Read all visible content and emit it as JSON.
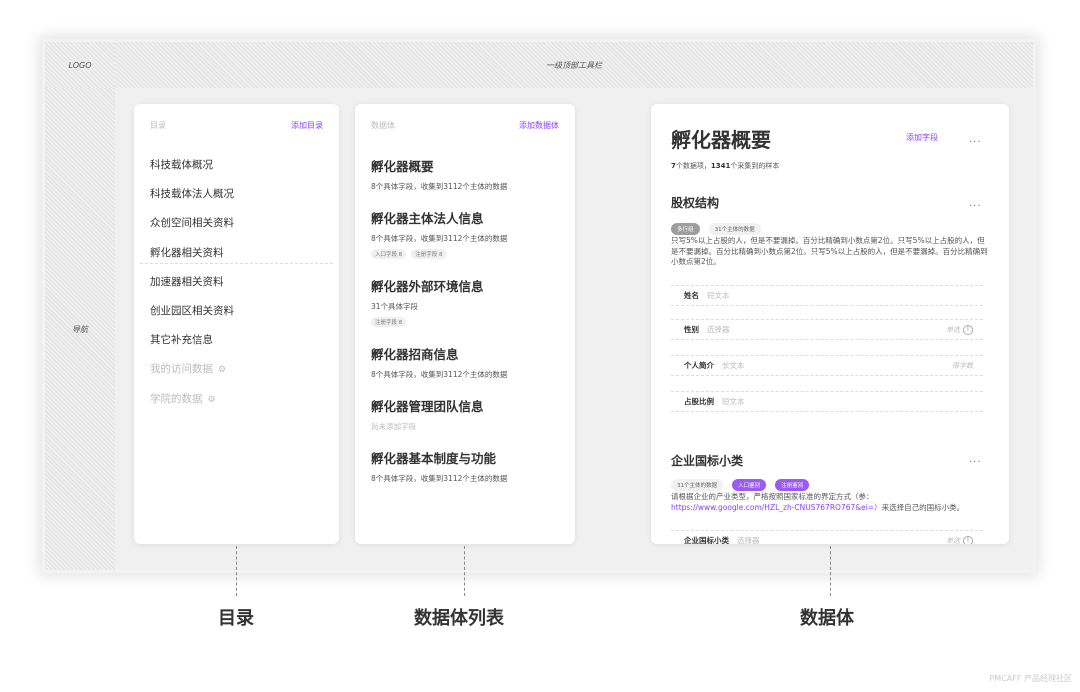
{
  "logo": "LOGO",
  "topbar": "一级顶部工具栏",
  "nav": "导航",
  "directory": {
    "title": "目录",
    "add": "添加目录",
    "items": [
      {
        "label": "科技载体概况",
        "muted": false
      },
      {
        "label": "科技载体法人概况",
        "muted": false
      },
      {
        "label": "众创空间相关资料",
        "muted": false
      },
      {
        "label": "孵化器相关资料",
        "muted": false
      },
      {
        "label": "加速器相关资料",
        "muted": false
      },
      {
        "label": "创业园区相关资料",
        "muted": false
      },
      {
        "label": "其它补充信息",
        "muted": false
      },
      {
        "label": "我的访问数据",
        "muted": true
      },
      {
        "label": "学院的数据",
        "muted": true
      }
    ]
  },
  "databodies": {
    "title": "数据体",
    "add": "添加数据体",
    "items": [
      {
        "title": "孵化器概要",
        "desc": "8个具体字段，收集到3112个主体的数据",
        "tags": []
      },
      {
        "title": "孵化器主体法人信息",
        "desc": "8个具体字段，收集到3112个主体的数据",
        "tags": [
          "入口字段 8",
          "注册字段 8"
        ]
      },
      {
        "title": "孵化器外部环境信息",
        "desc": "31个具体字段",
        "tags": [
          "注册字段 8"
        ]
      },
      {
        "title": "孵化器招商信息",
        "desc": "8个具体字段，收集到3112个主体的数据",
        "tags": []
      },
      {
        "title": "孵化器管理团队信息",
        "desc": "尚未添加字段",
        "tags": []
      },
      {
        "title": "孵化器基本制度与功能",
        "desc": "8个具体字段，收集到3112个主体的数据",
        "tags": []
      }
    ]
  },
  "detail": {
    "title": "孵化器概要",
    "add": "添加字段",
    "more": "...",
    "summary_count": "7",
    "summary_mid": "个数据项，",
    "summary_samples": "1341",
    "summary_end": "个采集到的样本",
    "section1": {
      "title": "股权结构",
      "pills": [
        "多行组",
        "31个主体的数据"
      ],
      "paragraph": "只写5%以上占股的人，但是不要漏掉。百分比精确到小数点第2位。只写5%以上占股的人，但是不要漏掉。百分比精确到小数点第2位。只写5%以上占股的人，但是不要漏掉。百分比精确到小数点第2位。",
      "fields": [
        {
          "label": "姓名",
          "placeholder": "短文本",
          "right": ""
        },
        {
          "label": "性别",
          "placeholder": "选择器",
          "right": "单选"
        },
        {
          "label": "个人简介",
          "placeholder": "长文本",
          "right": "限字数"
        },
        {
          "label": "占股比例",
          "placeholder": "短文本",
          "right": ""
        }
      ]
    },
    "section2": {
      "title": "企业国标小类",
      "pills": [
        "31个主体的数据",
        "入口鉴别",
        "注册鉴别"
      ],
      "para_text": "请根据企业的产业类型，严格按照国家标准的界定方式（参：",
      "para_link": "https://www.google.com/HZL_zh-CNUS767RO767&ei=）",
      "para_end": "来选择自己的国标小类。",
      "field": {
        "label": "企业国标小类",
        "placeholder": "选择器",
        "right": "单选"
      }
    }
  },
  "captions": {
    "directory": "目录",
    "list": "数据体列表",
    "body": "数据体"
  },
  "watermark": "PMCAFF 产品经理社区",
  "accent": "#8a3ffc"
}
